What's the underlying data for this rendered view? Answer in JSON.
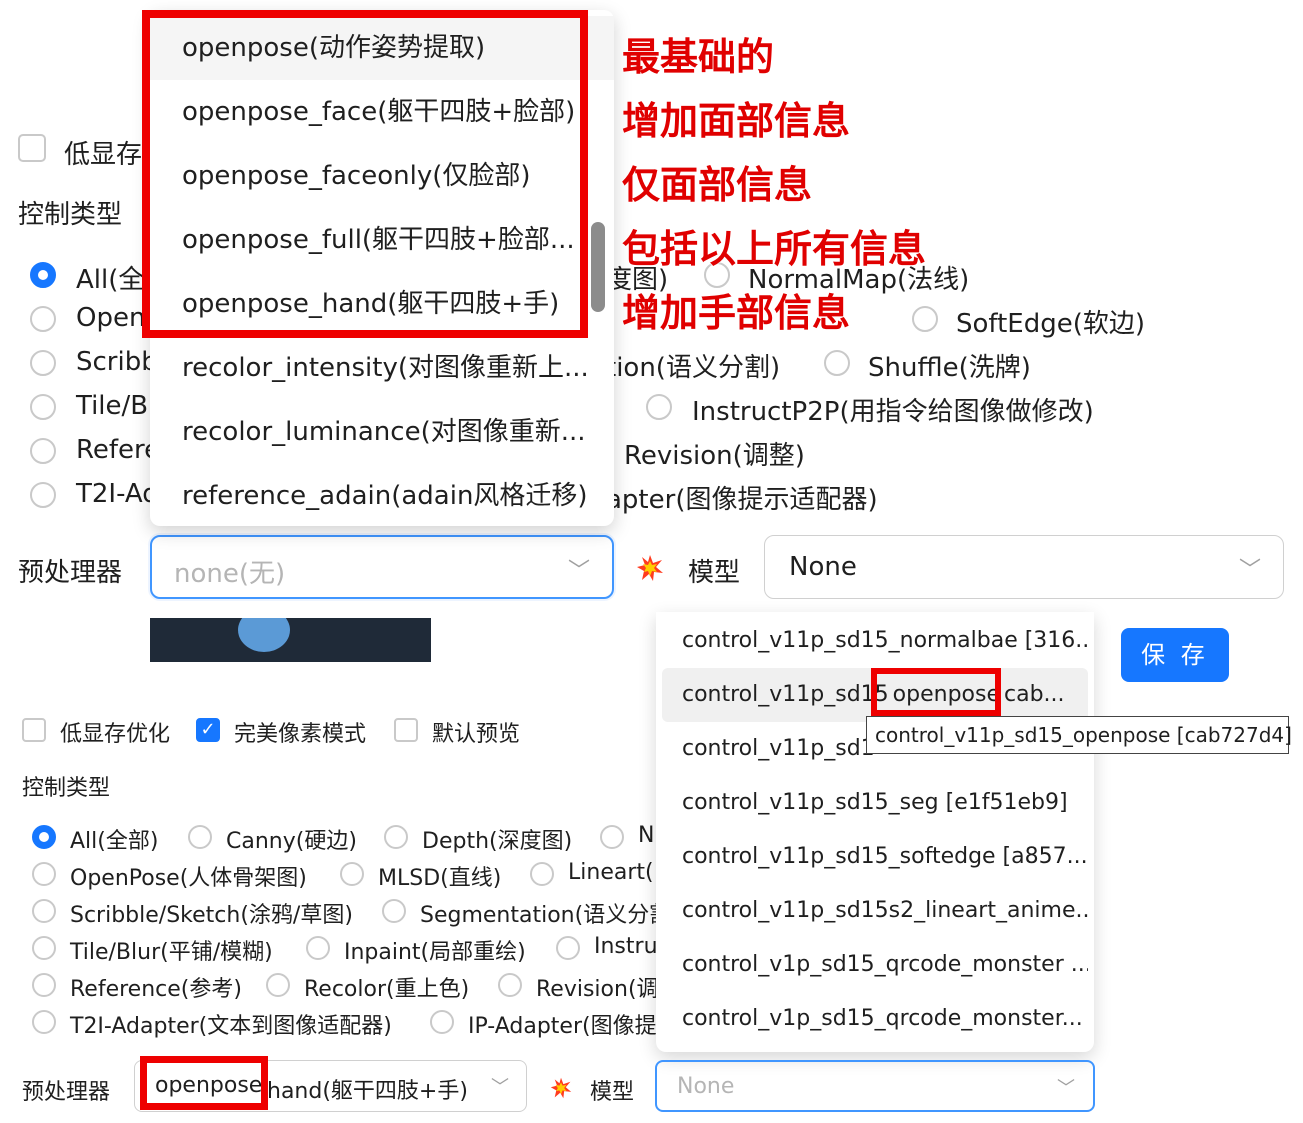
{
  "top": {
    "low_vram_label": "低显存",
    "control_type_label": "控制类型",
    "radios_partial": {
      "r1": "All(全",
      "r2": "Open",
      "r3": "Scribb",
      "r4": "Tile/Bl",
      "r5": "Refere",
      "r6": "T2I-Ad"
    },
    "visible_right": {
      "depth_frag": "度图)",
      "normalmap": "NormalMap(法线)",
      "softedge": "SoftEdge(软边)",
      "segmentation_frag": "tion(语义分割)",
      "shuffle": "Shuffle(洗牌)",
      "instructp2p": "InstructP2P(用指令给图像做修改)",
      "revision": "Revision(调整)",
      "ipadapter_frag": "apter(图像提示适配器)"
    },
    "preprocessor_label": "预处理器",
    "preprocessor_value": "none(无)",
    "model_label": "模型",
    "model_value": "None",
    "dropdown_items": [
      "openpose(动作姿势提取)",
      "openpose_face(躯干四肢+脸部)",
      "openpose_faceonly(仅脸部)",
      "openpose_full(躯干四肢+脸部...",
      "openpose_hand(躯干四肢+手)",
      "recolor_intensity(对图像重新上...",
      "recolor_luminance(对图像重新...",
      "reference_adain(adain风格迁移)"
    ],
    "annotations": [
      "最基础的",
      "增加面部信息",
      "仅面部信息",
      "包括以上所有信息",
      "增加手部信息"
    ]
  },
  "bottom": {
    "low_vram_label": "低显存优化",
    "pixel_perfect_label": "完美像素模式",
    "default_preview_label": "默认预览",
    "control_type_label": "控制类型",
    "radios": {
      "all": "All(全部)",
      "canny": "Canny(硬边)",
      "depth": "Depth(深度图)",
      "n_frag": "N",
      "openpose": "OpenPose(人体骨架图)",
      "mlsd": "MLSD(直线)",
      "lineart_frag": "Lineart(",
      "scribble": "Scribble/Sketch(涂鸦/草图)",
      "segmentation_frag": "Segmentation(语义分割",
      "tile": "Tile/Blur(平铺/模糊)",
      "inpaint": "Inpaint(局部重绘)",
      "instru_frag": "Instru",
      "reference": "Reference(参考)",
      "recolor": "Recolor(重上色)",
      "revision_frag": "Revision(调",
      "t2i": "T2I-Adapter(文本到图像适配器)",
      "ipadapter_frag": "IP-Adapter(图像提"
    },
    "preprocessor_label": "预处理器",
    "preprocessor_highlight": "openpose",
    "preprocessor_rest": "hand(躯干四肢+手)",
    "model_label": "模型",
    "model_value": "None",
    "save_label": "保 存",
    "tooltip": "control_v11p_sd15_openpose [cab727d4]",
    "model_items": [
      "control_v11p_sd15_normalbae [316...",
      "control_v11p_sd15",
      "control_v11p_sd1",
      "control_v11p_sd15_seg [e1f51eb9]",
      "control_v11p_sd15_softedge [a857...",
      "control_v11p_sd15s2_lineart_anime...",
      "control_v1p_sd15_qrcode_monster ...",
      "control_v1p_sd15_qrcode_monster..."
    ],
    "model_item2_highlight": "openpose",
    "model_item2_rest": "cab..."
  },
  "colors": {
    "accent": "#1677ff",
    "annotation": "#e00000",
    "highlight_box": "#ee0000"
  }
}
